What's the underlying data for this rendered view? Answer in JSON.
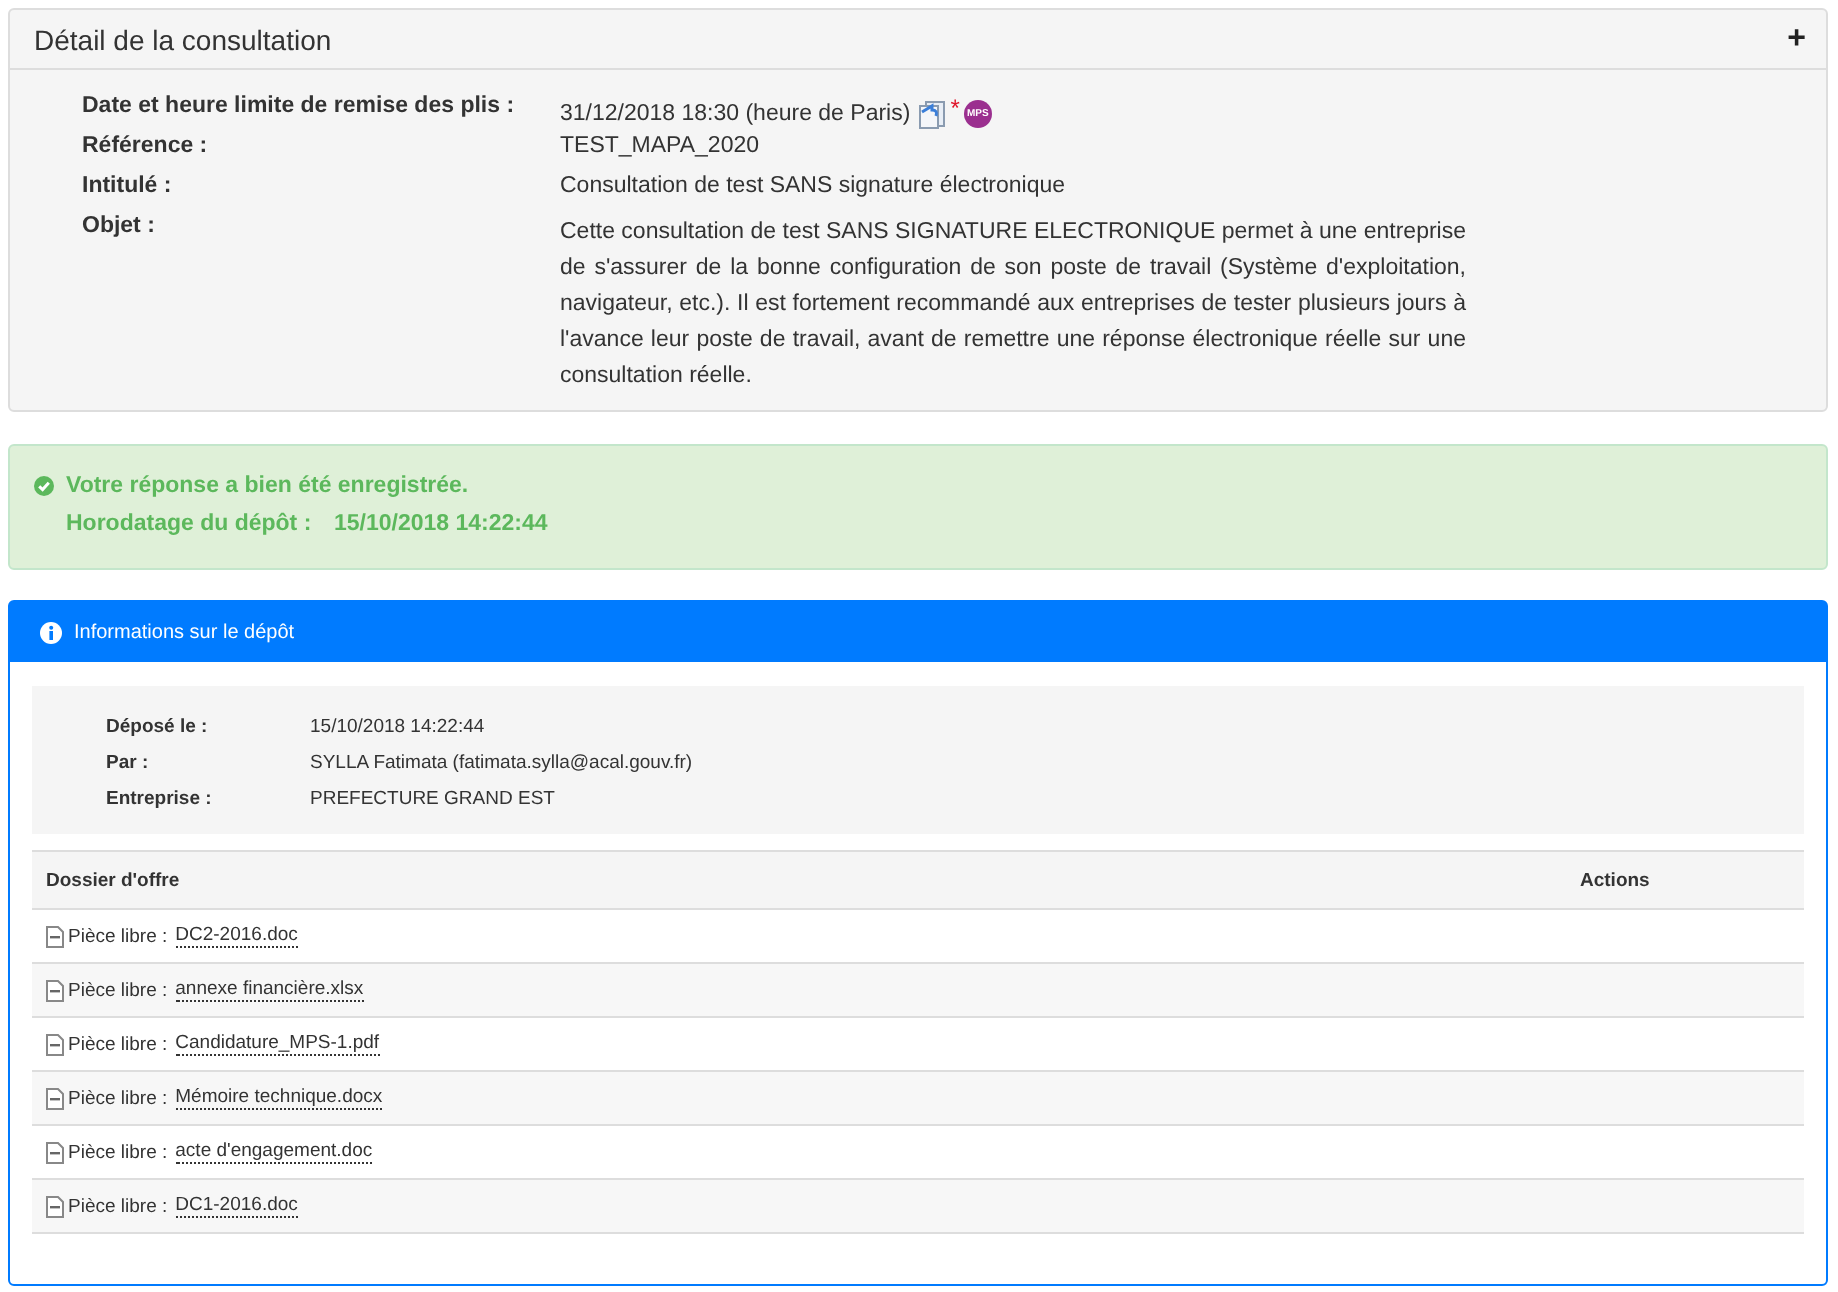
{
  "detail_panel": {
    "title": "Détail de la consultation",
    "toggle": "+",
    "fields": [
      {
        "label": "Date et heure limite de remise des plis :",
        "value": "31/12/2018 18:30 (heure de Paris)",
        "kind": "deadline",
        "asterisk": "*",
        "badge": "MPS"
      },
      {
        "label": "Référence :",
        "value": "TEST_MAPA_2020",
        "kind": "text"
      },
      {
        "label": "Intitulé :",
        "value": "Consultation de test SANS signature électronique",
        "kind": "text"
      },
      {
        "label": "Objet :",
        "value": "Cette consultation de test SANS SIGNATURE ELECTRONIQUE permet à une entreprise de s'assurer de la bonne configuration de son poste de travail (Système d'exploitation, navigateur, etc.). Il est fortement recommandé aux entreprises de tester plusieurs jours à l'avance leur poste de travail, avant de remettre une réponse électronique réelle sur une consultation réelle.",
        "kind": "paragraph"
      }
    ]
  },
  "success_alert": {
    "message": "Votre réponse a bien été enregistrée.",
    "timestamp_label": "Horodatage du dépôt :",
    "timestamp": "15/10/2018 14:22:44"
  },
  "deposit_panel": {
    "title": "Informations sur le dépôt",
    "fields": [
      {
        "label": "Déposé le :",
        "value": "15/10/2018 14:22:44"
      },
      {
        "label": "Par :",
        "value": "SYLLA Fatimata (fatimata.sylla@acal.gouv.fr)"
      },
      {
        "label": "Entreprise :",
        "value": "PREFECTURE GRAND EST"
      }
    ],
    "table": {
      "columns": [
        "Dossier d'offre",
        "Actions"
      ],
      "rows": [
        {
          "prefix": "Pièce libre :",
          "file": "DC2-2016.doc"
        },
        {
          "prefix": "Pièce libre :",
          "file": "annexe financière.xlsx"
        },
        {
          "prefix": "Pièce libre :",
          "file": "Candidature_MPS-1.pdf"
        },
        {
          "prefix": "Pièce libre :",
          "file": "Mémoire technique.docx"
        },
        {
          "prefix": "Pièce libre :",
          "file": "acte d'engagement.doc"
        },
        {
          "prefix": "Pièce libre :",
          "file": "DC1-2016.doc"
        }
      ]
    }
  }
}
